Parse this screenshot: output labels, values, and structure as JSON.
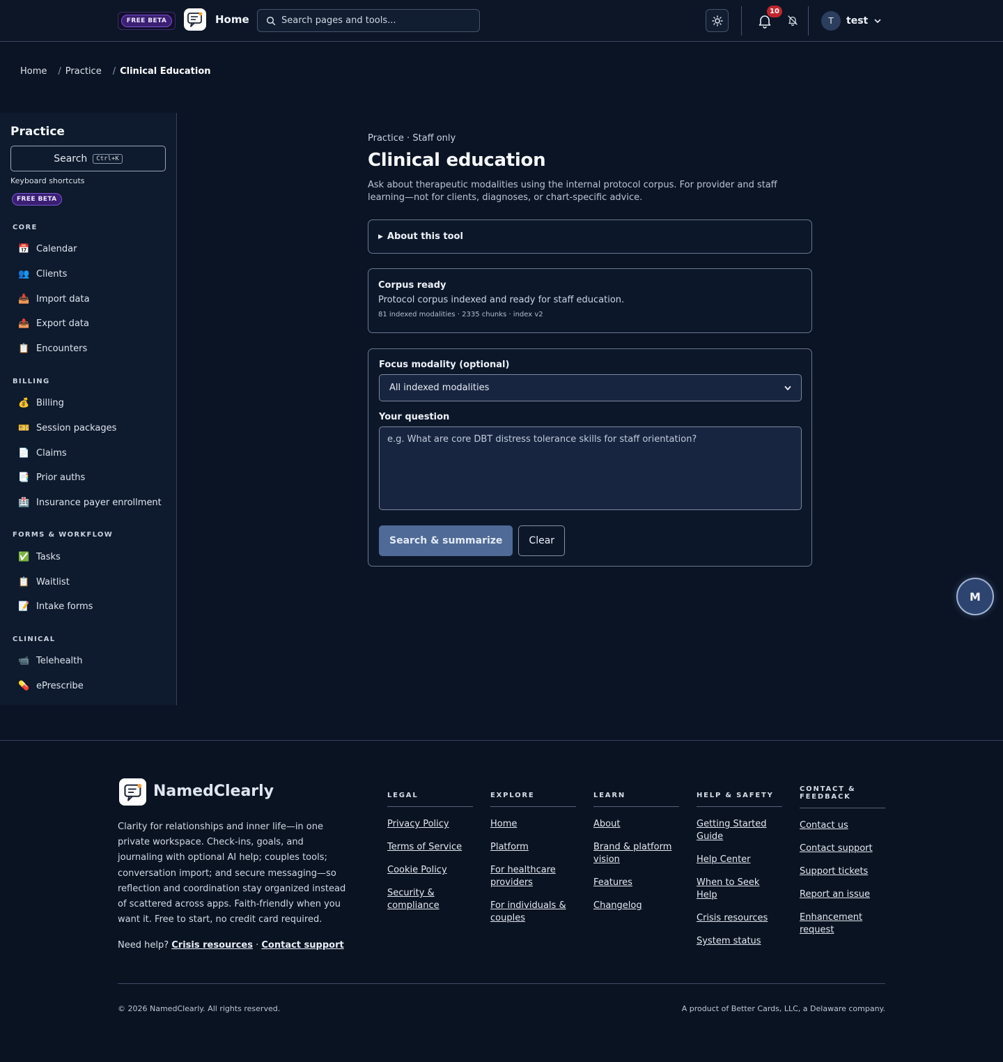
{
  "topnav": {
    "beta_badge": "FREE BETA",
    "home_label": "Home",
    "search_placeholder": "Search pages and tools...",
    "notification_count": "10",
    "user_initial": "T",
    "user_name": "test"
  },
  "breadcrumb": {
    "items": [
      "Home",
      "Practice"
    ],
    "current": "Clinical Education"
  },
  "sidebar": {
    "title": "Practice",
    "search_label": "Search",
    "search_shortcut": "Ctrl+K",
    "shortcuts_label": "Keyboard shortcuts",
    "beta_badge": "FREE BETA",
    "sections": [
      {
        "title": "CORE",
        "items": [
          {
            "icon": "📅",
            "icon_name": "calendar-icon",
            "label": "Calendar"
          },
          {
            "icon": "👥",
            "icon_name": "clients-icon",
            "label": "Clients"
          },
          {
            "icon": "📥",
            "icon_name": "inbox-tray-icon",
            "label": "Import data"
          },
          {
            "icon": "📤",
            "icon_name": "outbox-tray-icon",
            "label": "Export data"
          },
          {
            "icon": "📋",
            "icon_name": "clipboard-icon",
            "label": "Encounters"
          }
        ]
      },
      {
        "title": "BILLING",
        "items": [
          {
            "icon": "💰",
            "icon_name": "money-bag-icon",
            "label": "Billing"
          },
          {
            "icon": "🎫",
            "icon_name": "ticket-icon",
            "label": "Session packages"
          },
          {
            "icon": "📄",
            "icon_name": "document-icon",
            "label": "Claims"
          },
          {
            "icon": "📑",
            "icon_name": "bookmark-tabs-icon",
            "label": "Prior auths"
          },
          {
            "icon": "🏥",
            "icon_name": "hospital-icon",
            "label": "Insurance payer enrollment"
          }
        ]
      },
      {
        "title": "FORMS & WORKFLOW",
        "items": [
          {
            "icon": "✅",
            "icon_name": "check-icon",
            "label": "Tasks"
          },
          {
            "icon": "📋",
            "icon_name": "clipboard-icon",
            "label": "Waitlist"
          },
          {
            "icon": "📝",
            "icon_name": "memo-icon",
            "label": "Intake forms"
          }
        ]
      },
      {
        "title": "CLINICAL",
        "items": [
          {
            "icon": "📹",
            "icon_name": "video-camera-icon",
            "label": "Telehealth"
          },
          {
            "icon": "💊",
            "icon_name": "pill-icon",
            "label": "ePrescribe"
          }
        ]
      }
    ]
  },
  "main": {
    "eyebrow": "Practice · Staff only",
    "title": "Clinical education",
    "description": "Ask about therapeutic modalities using the internal protocol corpus. For provider and staff learning—not for clients, diagnoses, or chart-specific advice.",
    "about_toggle": "About this tool",
    "status": {
      "title": "Corpus ready",
      "text": "Protocol corpus indexed and ready for staff education.",
      "meta": "81 indexed modalities · 2335 chunks · index v2"
    },
    "form": {
      "modality_label": "Focus modality (optional)",
      "modality_value": "All indexed modalities",
      "question_label": "Your question",
      "question_placeholder": "e.g. What are core DBT distress tolerance skills for staff orientation?",
      "submit_label": "Search & summarize",
      "clear_label": "Clear"
    }
  },
  "fab": {
    "label": "M"
  },
  "footer": {
    "brand": "NamedClearly",
    "tagline": "Clarity for relationships and inner life—in one private workspace. Check-ins, goals, and journaling with optional AI help; couples tools; conversation import; and secure messaging—so reflection and coordination stay organized instead of scattered across apps. Faith-friendly when you want it. Free to start, no credit card required.",
    "help_prefix": "Need help?",
    "help_link1": "Crisis resources",
    "help_sep": "·",
    "help_link2": "Contact support",
    "columns": [
      {
        "title": "LEGAL",
        "links": [
          "Privacy Policy",
          "Terms of Service",
          "Cookie Policy",
          "Security & compliance"
        ]
      },
      {
        "title": "EXPLORE",
        "links": [
          "Home",
          "Platform",
          "For healthcare providers",
          "For individuals & couples"
        ]
      },
      {
        "title": "LEARN",
        "links": [
          "About",
          "Brand & platform vision",
          "Features",
          "Changelog"
        ]
      },
      {
        "title": "HELP & SAFETY",
        "links": [
          "Getting Started Guide",
          "Help Center",
          "When to Seek Help",
          "Crisis resources",
          "System status"
        ]
      },
      {
        "title": "CONTACT & FEEDBACK",
        "links": [
          "Contact us",
          "Contact support",
          "Support tickets",
          "Report an issue",
          "Enhancement request"
        ]
      }
    ],
    "copyright": "© 2026 NamedClearly. All rights reserved.",
    "company": "A product of Better Cards, LLC, a Delaware company."
  }
}
